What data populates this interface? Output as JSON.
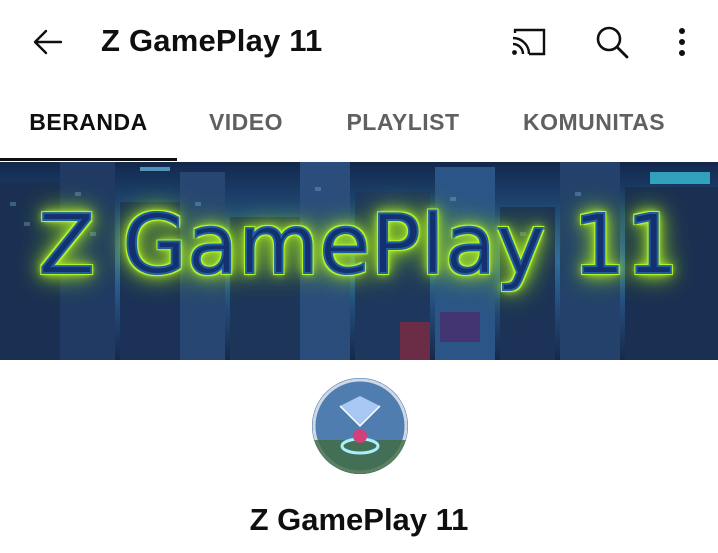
{
  "appbar": {
    "title": "Z GamePlay 11",
    "icons": [
      "back-arrow-icon",
      "cast-icon",
      "search-icon",
      "more-vert-icon"
    ]
  },
  "tabs": [
    {
      "label": "BERANDA",
      "active": true
    },
    {
      "label": "VIDEO",
      "active": false
    },
    {
      "label": "PLAYLIST",
      "active": false
    },
    {
      "label": "KOMUNITAS",
      "active": false
    }
  ],
  "banner": {
    "text": "Z GamePlay 11",
    "glow_color": "#b8f22a",
    "text_color": "#15306e"
  },
  "channel": {
    "name": "Z GamePlay 11"
  },
  "colors": {
    "text_primary": "#0f0f0f",
    "text_secondary": "#606060",
    "divider": "#e5e5e5"
  }
}
